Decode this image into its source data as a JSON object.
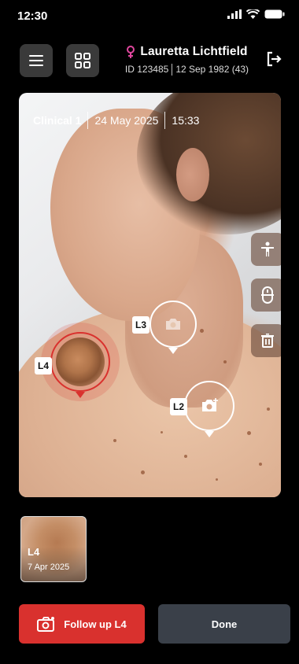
{
  "status_bar": {
    "time": "12:30"
  },
  "header": {
    "patient_name": "Lauretta Lichtfield",
    "patient_id": "ID 123485",
    "patient_dob": "12 Sep 1982 (43)"
  },
  "photo": {
    "title": "Clinical 1",
    "date": "24 May 2025",
    "time": "15:33",
    "markers": [
      {
        "label": "L3"
      },
      {
        "label": "L4"
      },
      {
        "label": "L2"
      }
    ],
    "tools": [
      "person-icon",
      "mouse-icon",
      "trash-icon"
    ]
  },
  "thumbnail": {
    "label": "L4",
    "date": "7 Apr 2025"
  },
  "actions": {
    "follow_up_label": "Follow up L4",
    "done_label": "Done"
  },
  "colors": {
    "accent_red": "#d9312e",
    "done_button": "#3a4049",
    "gender_icon": "#e0479e"
  }
}
